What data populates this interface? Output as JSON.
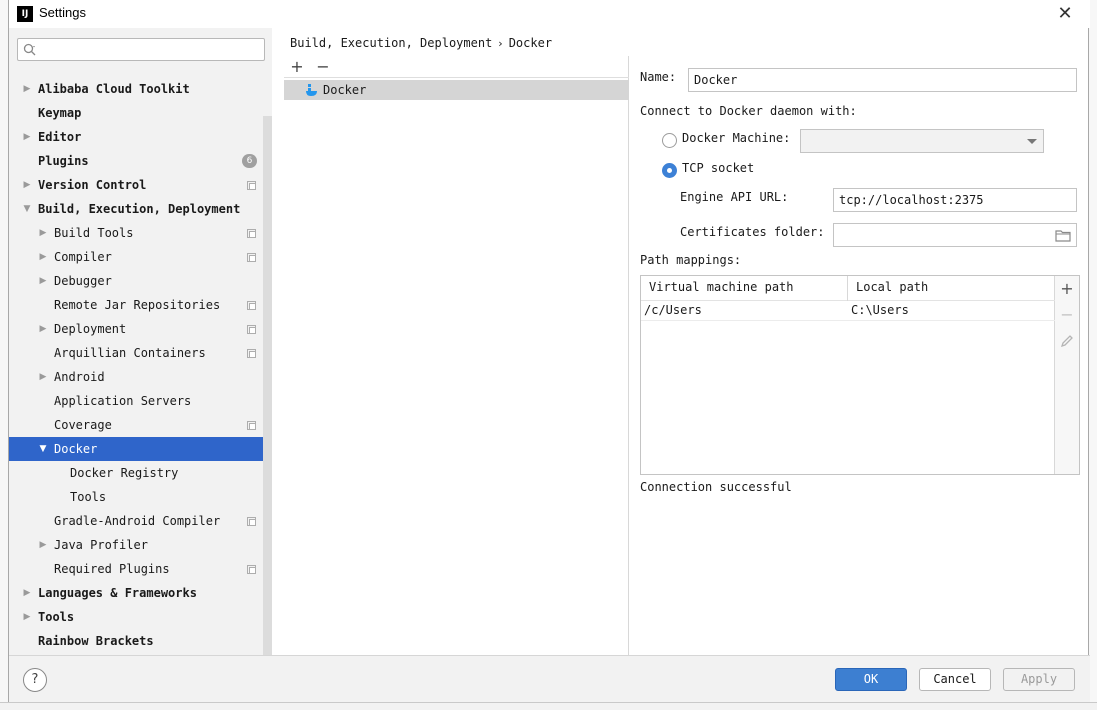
{
  "window": {
    "title": "Settings",
    "app_icon_text": "IJ"
  },
  "search": {
    "placeholder": "",
    "value": ""
  },
  "tree": [
    {
      "label": "Alibaba Cloud Toolkit",
      "bold": true,
      "arrow": "right",
      "level": 0
    },
    {
      "label": "Keymap",
      "bold": true,
      "arrow": "",
      "level": 0
    },
    {
      "label": "Editor",
      "bold": true,
      "arrow": "right",
      "level": 0
    },
    {
      "label": "Plugins",
      "bold": true,
      "arrow": "",
      "level": 0,
      "badge": "6"
    },
    {
      "label": "Version Control",
      "bold": true,
      "arrow": "right",
      "level": 0,
      "copy": true
    },
    {
      "label": "Build, Execution, Deployment",
      "bold": true,
      "arrow": "down",
      "level": 0
    },
    {
      "label": "Build Tools",
      "bold": false,
      "arrow": "right",
      "level": 1,
      "copy": true
    },
    {
      "label": "Compiler",
      "bold": false,
      "arrow": "right",
      "level": 1,
      "copy": true
    },
    {
      "label": "Debugger",
      "bold": false,
      "arrow": "right",
      "level": 1
    },
    {
      "label": "Remote Jar Repositories",
      "bold": false,
      "arrow": "",
      "level": 1,
      "copy": true
    },
    {
      "label": "Deployment",
      "bold": false,
      "arrow": "right",
      "level": 1,
      "copy": true
    },
    {
      "label": "Arquillian Containers",
      "bold": false,
      "arrow": "",
      "level": 1,
      "copy": true
    },
    {
      "label": "Android",
      "bold": false,
      "arrow": "right",
      "level": 1
    },
    {
      "label": "Application Servers",
      "bold": false,
      "arrow": "",
      "level": 1
    },
    {
      "label": "Coverage",
      "bold": false,
      "arrow": "",
      "level": 1,
      "copy": true
    },
    {
      "label": "Docker",
      "bold": false,
      "arrow": "down",
      "level": 1,
      "selected": true
    },
    {
      "label": "Docker Registry",
      "bold": false,
      "arrow": "",
      "level": 2
    },
    {
      "label": "Tools",
      "bold": false,
      "arrow": "",
      "level": 2
    },
    {
      "label": "Gradle-Android Compiler",
      "bold": false,
      "arrow": "",
      "level": 1,
      "copy": true
    },
    {
      "label": "Java Profiler",
      "bold": false,
      "arrow": "right",
      "level": 1
    },
    {
      "label": "Required Plugins",
      "bold": false,
      "arrow": "",
      "level": 1,
      "copy": true
    },
    {
      "label": "Languages & Frameworks",
      "bold": true,
      "arrow": "right",
      "level": 0
    },
    {
      "label": "Tools",
      "bold": true,
      "arrow": "right",
      "level": 0
    },
    {
      "label": "Rainbow Brackets",
      "bold": true,
      "arrow": "",
      "level": 0
    }
  ],
  "breadcrumb": {
    "parent": "Build, Execution, Deployment",
    "separator": "›",
    "current": "Docker"
  },
  "middle": {
    "add_label": "+",
    "remove_label": "−",
    "items": [
      {
        "label": "Docker",
        "icon": "docker-icon"
      }
    ]
  },
  "form": {
    "name_label": "Name:",
    "name_value": "Docker",
    "connect_label": "Connect to Docker daemon with:",
    "docker_machine_label": "Docker Machine:",
    "docker_machine_value": "",
    "tcp_socket_label": "TCP socket",
    "engine_api_label": "Engine API URL:",
    "engine_api_value": "tcp://localhost:2375",
    "certificates_label": "Certificates folder:",
    "certificates_value": "",
    "path_mappings_label": "Path mappings:",
    "table": {
      "headers": [
        "Virtual machine path",
        "Local path"
      ],
      "rows": [
        [
          "/c/Users",
          "C:\\Users"
        ]
      ]
    },
    "status": "Connection successful"
  },
  "footer": {
    "help": "?",
    "ok": "OK",
    "cancel": "Cancel",
    "apply": "Apply"
  },
  "colors": {
    "selection": "#2f65ca",
    "primary_button": "#3d7fd1",
    "radio_checked": "#3d81d6"
  }
}
